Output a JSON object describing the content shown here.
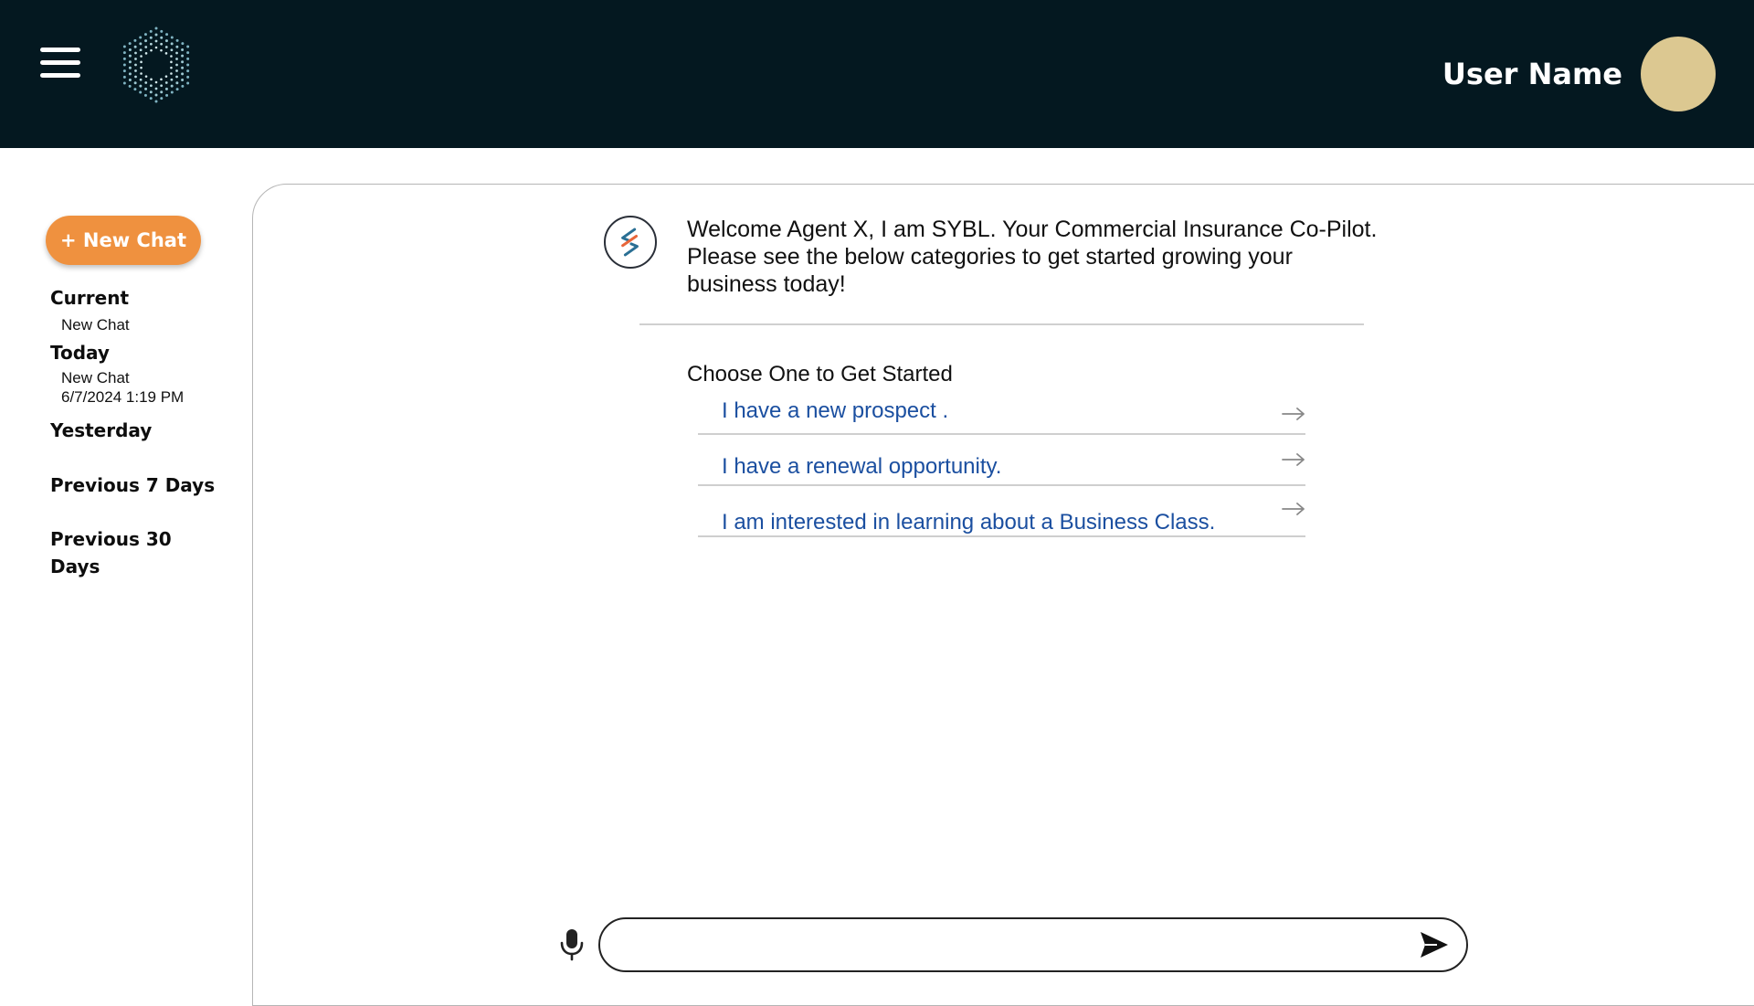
{
  "header": {
    "menu_icon": "hamburger-menu-icon",
    "logo_icon": "hexagon-dots-logo",
    "user_name": "User Name",
    "avatar_color": "#dcc891",
    "background": "#041820"
  },
  "sidebar": {
    "new_chat_label": "+ New Chat",
    "new_chat_color": "#ef913f",
    "sections": {
      "current": {
        "label": "Current",
        "items": [
          {
            "title": "New Chat"
          }
        ]
      },
      "today": {
        "label": "Today",
        "items": [
          {
            "title": "New Chat",
            "timestamp": "6/7/2024 1:19 PM"
          }
        ]
      },
      "yesterday": {
        "label": "Yesterday"
      },
      "previous_7": {
        "label": "Previous 7 Days"
      },
      "previous_30": {
        "label_line1": "Previous 30",
        "label_line2": "Days"
      }
    }
  },
  "chat": {
    "bot_icon": "sybl-logo-icon",
    "welcome_line1": "Welcome Agent X, I am SYBL. Your Commercial Insurance Co-Pilot.",
    "welcome_line2": "Please see the below categories to get started growing your",
    "welcome_line3": "business today!",
    "choose_title": "Choose One to Get Started",
    "options": [
      {
        "label": "I have a new prospect .",
        "icon": "arrow-right-icon"
      },
      {
        "label": "I have a renewal opportunity.",
        "icon": "arrow-right-icon"
      },
      {
        "label": "I am interested in learning about a Business Class.",
        "icon": "arrow-right-icon"
      }
    ],
    "option_color": "#1b4fa0"
  },
  "input": {
    "value": "",
    "placeholder": "",
    "mic_icon": "microphone-icon",
    "send_icon": "send-icon"
  }
}
